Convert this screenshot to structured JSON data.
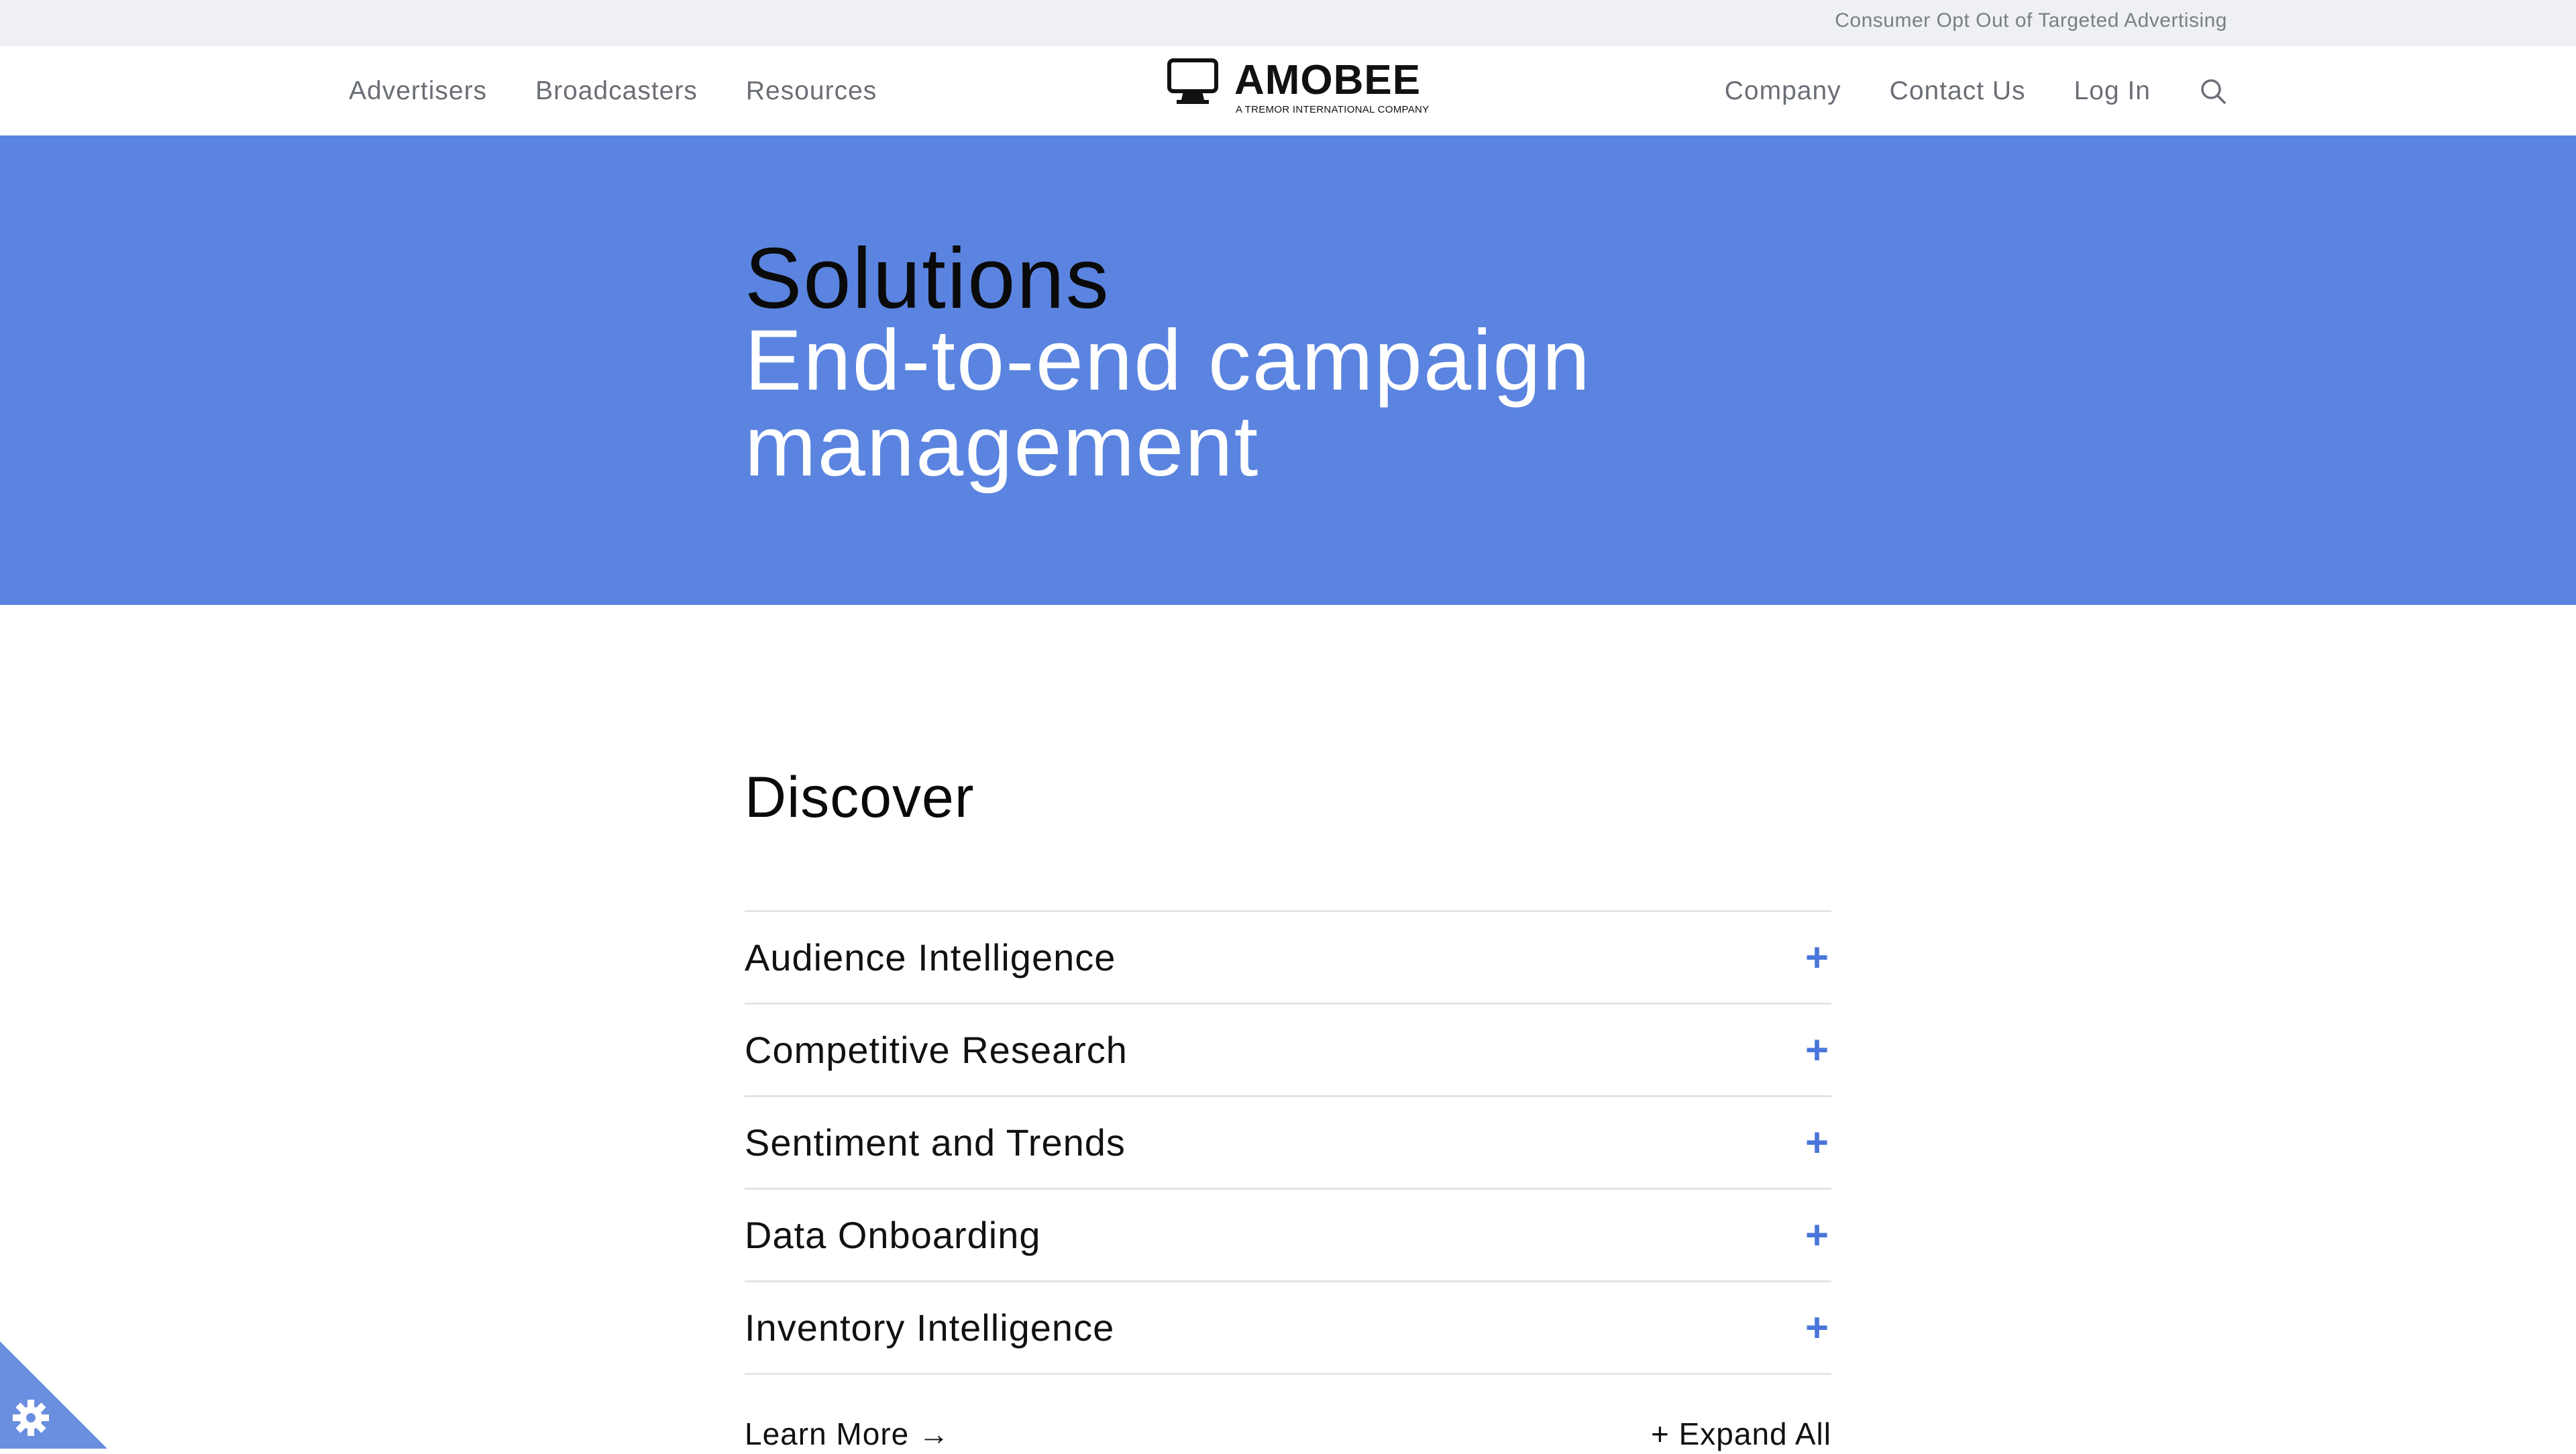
{
  "utility": {
    "opt_out_label": "Consumer Opt Out of Targeted Advertising"
  },
  "nav": {
    "left": [
      "Advertisers",
      "Broadcasters",
      "Resources"
    ],
    "right": [
      "Company",
      "Contact Us",
      "Log In"
    ],
    "search_icon": "search-icon"
  },
  "logo": {
    "word": "AMOBEE",
    "tagline": "A TREMOR INTERNATIONAL COMPANY",
    "icon": "monitor-icon"
  },
  "hero": {
    "title": "Solutions",
    "subtitle": "End-to-end campaign management",
    "background": "#5b84e0"
  },
  "discover": {
    "title": "Discover",
    "items": [
      {
        "label": "Audience Intelligence",
        "icon": "plus-icon"
      },
      {
        "label": "Competitive Research",
        "icon": "plus-icon"
      },
      {
        "label": "Sentiment and Trends",
        "icon": "plus-icon"
      },
      {
        "label": "Data Onboarding",
        "icon": "plus-icon"
      },
      {
        "label": "Inventory Intelligence",
        "icon": "plus-icon"
      }
    ],
    "learn_more": "Learn More →",
    "expand_all": "+ Expand All",
    "accent": "#4a76db"
  },
  "cookie": {
    "icon": "cookie-settings-icon",
    "color": "#6b8fe0"
  }
}
